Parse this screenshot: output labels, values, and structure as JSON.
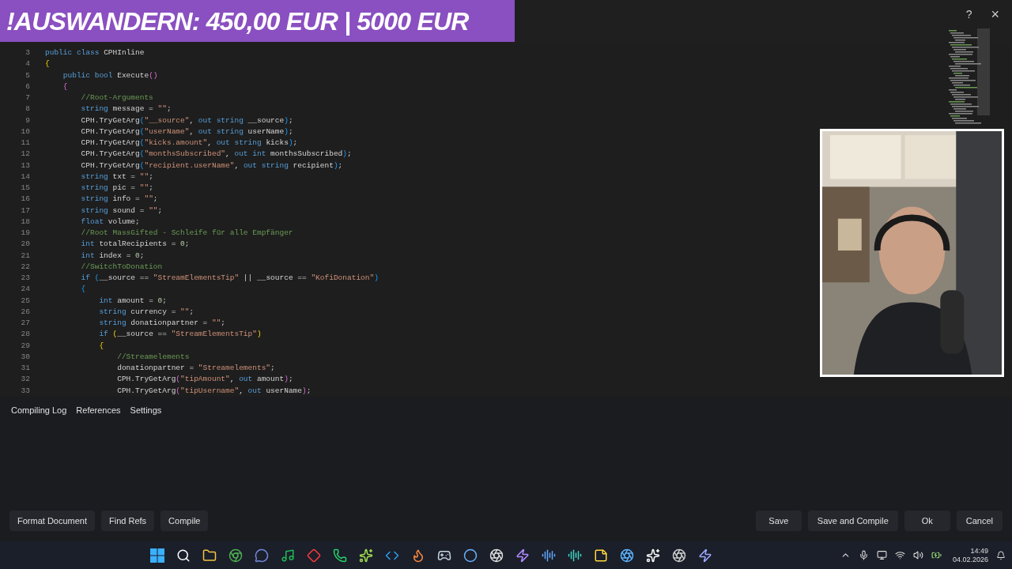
{
  "banner": {
    "text": "!AUSWANDERN: 450,00 EUR | 5000 EUR"
  },
  "window_controls": {
    "help": "?",
    "close": "×"
  },
  "editor": {
    "lines": [
      {
        "number": "3",
        "tokens": [
          {
            "kind": "kw",
            "text": "public class "
          },
          {
            "kind": "txt",
            "text": "CPHInline"
          }
        ]
      },
      {
        "number": "4",
        "tokens": [
          {
            "kind": "b1",
            "text": "{"
          }
        ]
      },
      {
        "number": "5",
        "tokens": [
          {
            "kind": "kw",
            "text": "    public bool "
          },
          {
            "kind": "txt",
            "text": "Execute"
          },
          {
            "kind": "b2",
            "text": "()"
          }
        ]
      },
      {
        "number": "6",
        "tokens": [
          {
            "kind": "b2",
            "text": "    {"
          }
        ]
      },
      {
        "number": "7",
        "tokens": [
          {
            "kind": "cmt",
            "text": "        //Root-Arguments"
          }
        ]
      },
      {
        "number": "8",
        "tokens": [
          {
            "kind": "kw",
            "text": "        string "
          },
          {
            "kind": "txt",
            "text": "message = "
          },
          {
            "kind": "str",
            "text": "\"\""
          },
          {
            "kind": "txt",
            "text": ";"
          }
        ]
      },
      {
        "number": "9",
        "tokens": [
          {
            "kind": "txt",
            "text": "        CPH.TryGetArg"
          },
          {
            "kind": "b3",
            "text": "("
          },
          {
            "kind": "str",
            "text": "\"__source\""
          },
          {
            "kind": "txt",
            "text": ", "
          },
          {
            "kind": "kw",
            "text": "out string "
          },
          {
            "kind": "txt",
            "text": "__source"
          },
          {
            "kind": "b3",
            "text": ")"
          },
          {
            "kind": "txt",
            "text": ";"
          }
        ]
      },
      {
        "number": "10",
        "tokens": [
          {
            "kind": "txt",
            "text": "        CPH.TryGetArg"
          },
          {
            "kind": "b3",
            "text": "("
          },
          {
            "kind": "str",
            "text": "\"userName\""
          },
          {
            "kind": "txt",
            "text": ", "
          },
          {
            "kind": "kw",
            "text": "out string "
          },
          {
            "kind": "txt",
            "text": "userName"
          },
          {
            "kind": "b3",
            "text": ")"
          },
          {
            "kind": "txt",
            "text": ";"
          }
        ]
      },
      {
        "number": "11",
        "tokens": [
          {
            "kind": "txt",
            "text": "        CPH.TryGetArg"
          },
          {
            "kind": "b3",
            "text": "("
          },
          {
            "kind": "str",
            "text": "\"kicks.amount\""
          },
          {
            "kind": "txt",
            "text": ", "
          },
          {
            "kind": "kw",
            "text": "out string "
          },
          {
            "kind": "txt",
            "text": "kicks"
          },
          {
            "kind": "b3",
            "text": ")"
          },
          {
            "kind": "txt",
            "text": ";"
          }
        ]
      },
      {
        "number": "12",
        "tokens": [
          {
            "kind": "txt",
            "text": "        CPH.TryGetArg"
          },
          {
            "kind": "b3",
            "text": "("
          },
          {
            "kind": "str",
            "text": "\"monthsSubscribed\""
          },
          {
            "kind": "txt",
            "text": ", "
          },
          {
            "kind": "kw",
            "text": "out int "
          },
          {
            "kind": "txt",
            "text": "monthsSubscribed"
          },
          {
            "kind": "b3",
            "text": ")"
          },
          {
            "kind": "txt",
            "text": ";"
          }
        ]
      },
      {
        "number": "13",
        "tokens": [
          {
            "kind": "txt",
            "text": "        CPH.TryGetArg"
          },
          {
            "kind": "b3",
            "text": "("
          },
          {
            "kind": "str",
            "text": "\"recipient.userName\""
          },
          {
            "kind": "txt",
            "text": ", "
          },
          {
            "kind": "kw",
            "text": "out string "
          },
          {
            "kind": "txt",
            "text": "recipient"
          },
          {
            "kind": "b3",
            "text": ")"
          },
          {
            "kind": "txt",
            "text": ";"
          }
        ]
      },
      {
        "number": "14",
        "tokens": [
          {
            "kind": "kw",
            "text": "        string "
          },
          {
            "kind": "txt",
            "text": "txt = "
          },
          {
            "kind": "str",
            "text": "\"\""
          },
          {
            "kind": "txt",
            "text": ";"
          }
        ]
      },
      {
        "number": "15",
        "tokens": [
          {
            "kind": "kw",
            "text": "        string "
          },
          {
            "kind": "txt",
            "text": "pic = "
          },
          {
            "kind": "str",
            "text": "\"\""
          },
          {
            "kind": "txt",
            "text": ";"
          }
        ]
      },
      {
        "number": "16",
        "tokens": [
          {
            "kind": "kw",
            "text": "        string "
          },
          {
            "kind": "txt",
            "text": "info = "
          },
          {
            "kind": "str",
            "text": "\"\""
          },
          {
            "kind": "txt",
            "text": ";"
          }
        ]
      },
      {
        "number": "17",
        "tokens": [
          {
            "kind": "kw",
            "text": "        string "
          },
          {
            "kind": "txt",
            "text": "sound = "
          },
          {
            "kind": "str",
            "text": "\"\""
          },
          {
            "kind": "txt",
            "text": ";"
          }
        ]
      },
      {
        "number": "18",
        "tokens": [
          {
            "kind": "kw",
            "text": "        float "
          },
          {
            "kind": "txt",
            "text": "volume;"
          }
        ]
      },
      {
        "number": "19",
        "tokens": [
          {
            "kind": "cmt",
            "text": "        //Root MassGifted - Schleife für alle Empfänger"
          }
        ]
      },
      {
        "number": "20",
        "tokens": [
          {
            "kind": "kw",
            "text": "        int "
          },
          {
            "kind": "txt",
            "text": "totalRecipients = "
          },
          {
            "kind": "num",
            "text": "0"
          },
          {
            "kind": "txt",
            "text": ";"
          }
        ]
      },
      {
        "number": "21",
        "tokens": [
          {
            "kind": "kw",
            "text": "        int "
          },
          {
            "kind": "txt",
            "text": "index = "
          },
          {
            "kind": "num",
            "text": "0"
          },
          {
            "kind": "txt",
            "text": ";"
          }
        ]
      },
      {
        "number": "22",
        "tokens": [
          {
            "kind": "cmt",
            "text": "        //SwitchToDonation"
          }
        ]
      },
      {
        "number": "23",
        "tokens": [
          {
            "kind": "kw",
            "text": "        if "
          },
          {
            "kind": "b3",
            "text": "("
          },
          {
            "kind": "txt",
            "text": "__source == "
          },
          {
            "kind": "str",
            "text": "\"StreamElementsTip\""
          },
          {
            "kind": "txt",
            "text": " || __source == "
          },
          {
            "kind": "str",
            "text": "\"KofiDonation\""
          },
          {
            "kind": "b3",
            "text": ")"
          }
        ]
      },
      {
        "number": "24",
        "tokens": [
          {
            "kind": "b3",
            "text": "        {"
          }
        ]
      },
      {
        "number": "25",
        "tokens": [
          {
            "kind": "kw",
            "text": "            int "
          },
          {
            "kind": "txt",
            "text": "amount = "
          },
          {
            "kind": "num",
            "text": "0"
          },
          {
            "kind": "txt",
            "text": ";"
          }
        ]
      },
      {
        "number": "26",
        "tokens": [
          {
            "kind": "kw",
            "text": "            string "
          },
          {
            "kind": "txt",
            "text": "currency = "
          },
          {
            "kind": "str",
            "text": "\"\""
          },
          {
            "kind": "txt",
            "text": ";"
          }
        ]
      },
      {
        "number": "27",
        "tokens": [
          {
            "kind": "kw",
            "text": "            string "
          },
          {
            "kind": "txt",
            "text": "donationpartner = "
          },
          {
            "kind": "str",
            "text": "\"\""
          },
          {
            "kind": "txt",
            "text": ";"
          }
        ]
      },
      {
        "number": "28",
        "tokens": [
          {
            "kind": "kw",
            "text": "            if "
          },
          {
            "kind": "b1",
            "text": "("
          },
          {
            "kind": "txt",
            "text": "__source == "
          },
          {
            "kind": "str",
            "text": "\"StreamElementsTip\""
          },
          {
            "kind": "b1",
            "text": ")"
          }
        ]
      },
      {
        "number": "29",
        "tokens": [
          {
            "kind": "b1",
            "text": "            {"
          }
        ]
      },
      {
        "number": "30",
        "tokens": [
          {
            "kind": "cmt",
            "text": "                //Streamelements"
          }
        ]
      },
      {
        "number": "31",
        "tokens": [
          {
            "kind": "txt",
            "text": "                donationpartner = "
          },
          {
            "kind": "str",
            "text": "\"Streamelements\""
          },
          {
            "kind": "txt",
            "text": ";"
          }
        ]
      },
      {
        "number": "32",
        "tokens": [
          {
            "kind": "txt",
            "text": "                CPH.TryGetArg"
          },
          {
            "kind": "b2",
            "text": "("
          },
          {
            "kind": "str",
            "text": "\"tipAmount\""
          },
          {
            "kind": "txt",
            "text": ", "
          },
          {
            "kind": "kw",
            "text": "out "
          },
          {
            "kind": "txt",
            "text": "amount"
          },
          {
            "kind": "b2",
            "text": ")"
          },
          {
            "kind": "txt",
            "text": ";"
          }
        ]
      },
      {
        "number": "33",
        "tokens": [
          {
            "kind": "txt",
            "text": "                CPH.TryGetArg"
          },
          {
            "kind": "b2",
            "text": "("
          },
          {
            "kind": "str",
            "text": "\"tipUsername\""
          },
          {
            "kind": "txt",
            "text": ", "
          },
          {
            "kind": "kw",
            "text": "out "
          },
          {
            "kind": "txt",
            "text": "userName"
          },
          {
            "kind": "b2",
            "text": ")"
          },
          {
            "kind": "txt",
            "text": ";"
          }
        ]
      }
    ]
  },
  "webcam": {
    "kind": "picture"
  },
  "bottom_tabs": [
    {
      "label": "Compiling Log"
    },
    {
      "label": "References"
    },
    {
      "label": "Settings"
    }
  ],
  "left_buttons": [
    "Format Document",
    "Find Refs",
    "Compile"
  ],
  "right_buttons": [
    "Save",
    "Save and Compile",
    "Ok",
    "Cancel"
  ],
  "taskbar": {
    "time": "14:49",
    "date": "04.02.2026"
  }
}
